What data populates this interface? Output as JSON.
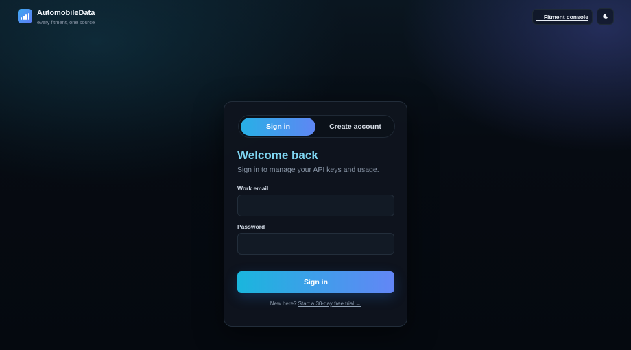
{
  "header": {
    "brand_name": "AutomobileData",
    "brand_tagline": "every fitment, one source",
    "console_link": "← Fitment console",
    "theme_icon": "moon-icon",
    "logo_icon": "bar-chart-icon"
  },
  "auth": {
    "tabs": [
      {
        "label": "Sign in",
        "active": true
      },
      {
        "label": "Create account",
        "active": false
      }
    ],
    "title": "Welcome back",
    "subtitle": "Sign in to manage your API keys and usage.",
    "email_label": "Work email",
    "email_value": "",
    "password_label": "Password",
    "password_value": "",
    "submit_label": "Sign in",
    "footer_prefix": "New here?",
    "footer_link": "Start a 30-day free trial →"
  },
  "colors": {
    "accent_start": "#27b0e6",
    "accent_end": "#5f86f3",
    "title": "#7fd6f2",
    "background": "#05090f"
  }
}
